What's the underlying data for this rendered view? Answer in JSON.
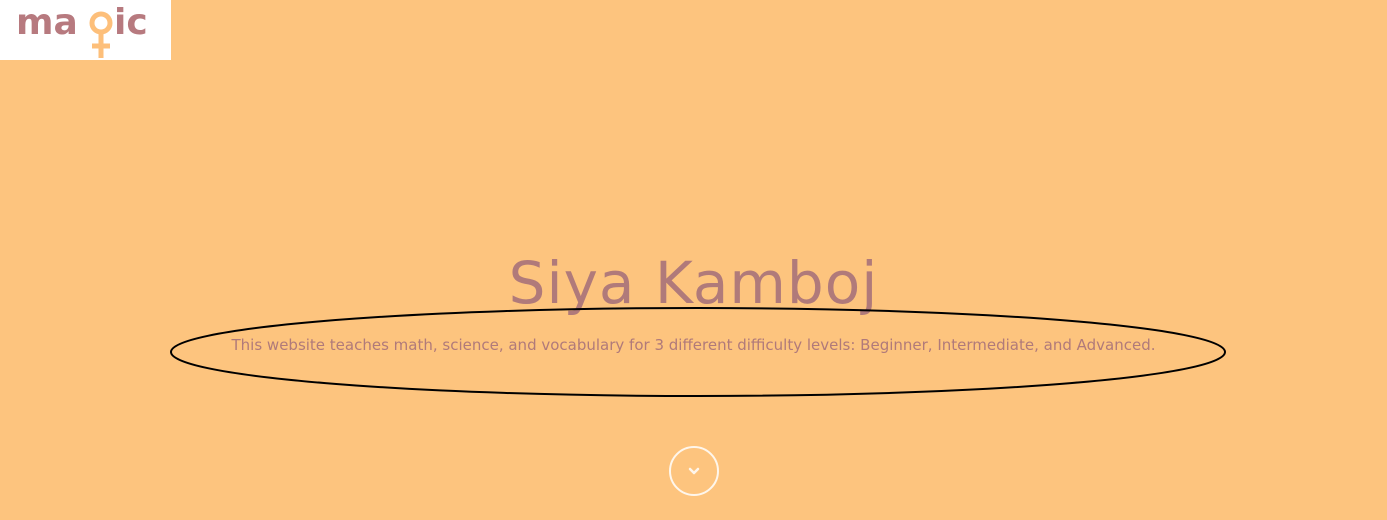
{
  "logo": {
    "text_m": "ma",
    "text_ic": "ic",
    "symbol": "female-symbol-icon"
  },
  "hero": {
    "title": "Siya Kamboj",
    "subtitle": "This website teaches math, science, and vocabulary for 3 different difficulty levels: Beginner, Intermediate, and Advanced."
  },
  "colors": {
    "background": "#fdc47e",
    "text": "#b07a7a",
    "logo_text": "#b77a7f",
    "logo_symbol": "#fdbf7a",
    "annotation": "#000000"
  },
  "scroll_button": {
    "icon": "chevron-down-icon"
  }
}
